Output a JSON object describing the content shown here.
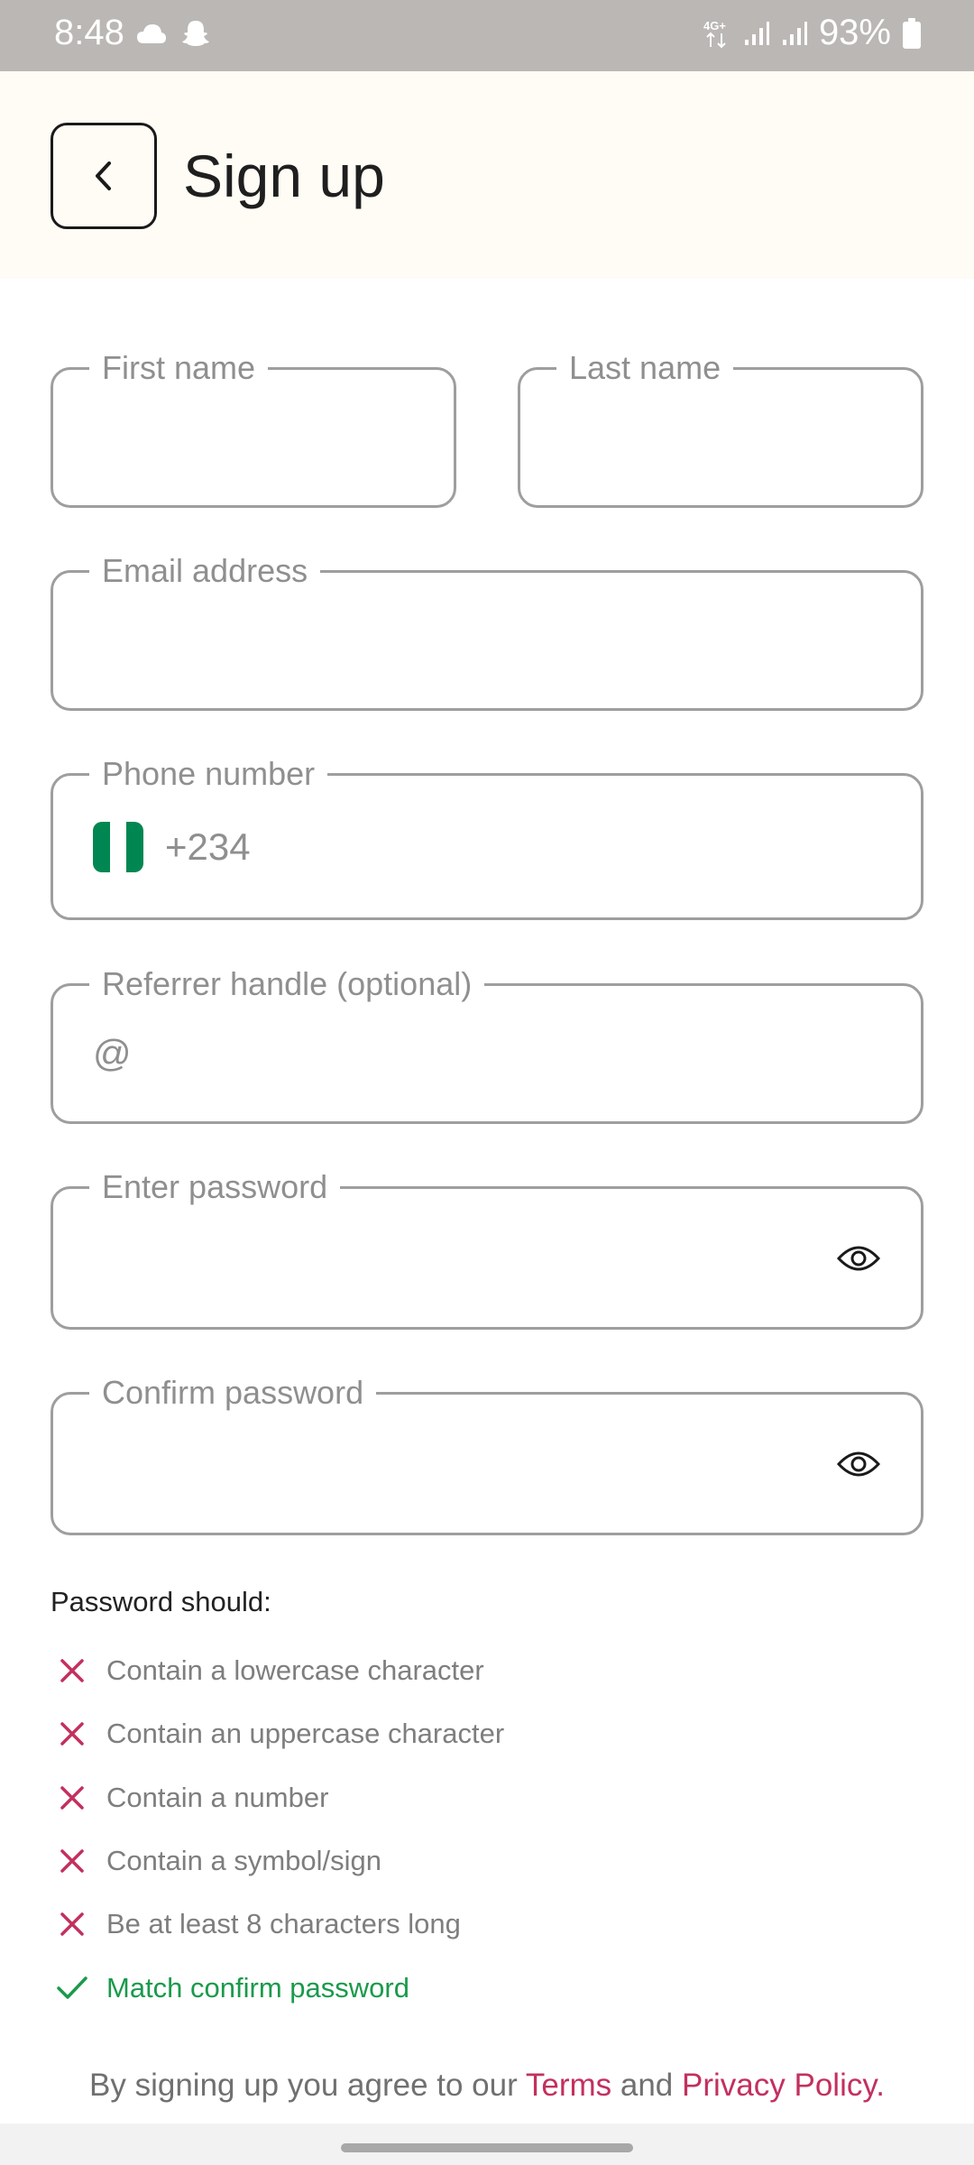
{
  "status_bar": {
    "time": "8:48",
    "network": "4G+",
    "battery_pct": "93%"
  },
  "header": {
    "title": "Sign up"
  },
  "form": {
    "first_name_label": "First name",
    "last_name_label": "Last name",
    "email_label": "Email address",
    "phone_label": "Phone number",
    "phone_code": "+234",
    "referrer_label": "Referrer handle (optional)",
    "referrer_prefix": "@",
    "password_label": "Enter password",
    "confirm_label": "Confirm password"
  },
  "rules": {
    "title": "Password should:",
    "items": [
      {
        "text": "Contain a lowercase character",
        "met": false
      },
      {
        "text": "Contain an uppercase character",
        "met": false
      },
      {
        "text": "Contain a number",
        "met": false
      },
      {
        "text": "Contain a symbol/sign",
        "met": false
      },
      {
        "text": "Be at least 8 characters long",
        "met": false
      },
      {
        "text": "Match confirm password",
        "met": true
      }
    ]
  },
  "terms": {
    "prefix": "By signing up you agree to our ",
    "terms_link": "Terms",
    "and": " and ",
    "privacy_link": "Privacy Policy."
  },
  "colors": {
    "header_bg": "#fffbf5",
    "error": "#c3305e",
    "success": "#1a9a4b",
    "flag_green": "#008751"
  }
}
